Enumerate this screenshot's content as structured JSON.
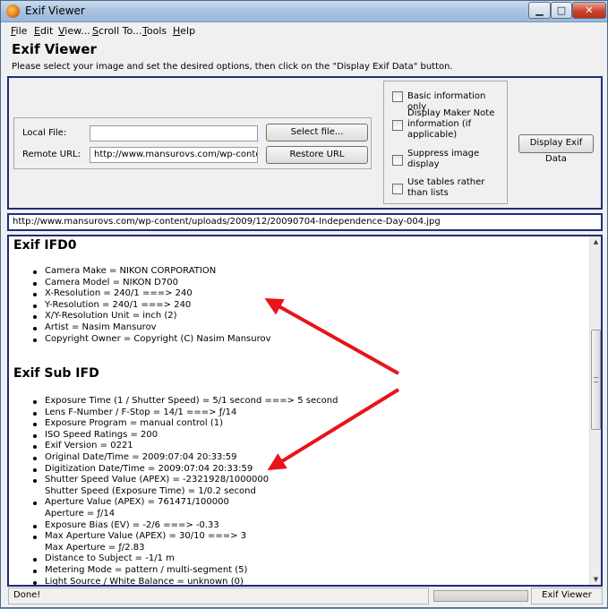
{
  "window": {
    "title": "Exif Viewer",
    "min_glyph": "▁",
    "max_glyph": "□",
    "close_glyph": "✕"
  },
  "menu": {
    "file": {
      "key": "F",
      "rest": "ile"
    },
    "edit": {
      "key": "E",
      "rest": "dit"
    },
    "view": {
      "key": "V",
      "rest": "iew..."
    },
    "scroll": {
      "key": "S",
      "rest": "croll To..."
    },
    "tools": {
      "key": "T",
      "rest": "ools"
    },
    "help": {
      "key": "H",
      "rest": "elp"
    }
  },
  "header": {
    "title": "Exif Viewer",
    "instructions": "Please select your image and set the desired options, then click on the \"Display Exif Data\" button."
  },
  "source": {
    "local_label": "Local File:",
    "local_value": "",
    "select_button": "Select file...",
    "remote_label": "Remote URL:",
    "remote_value": "http://www.mansurovs.com/wp-content",
    "restore_button": "Restore URL"
  },
  "options": {
    "basic": "Basic information only",
    "maker": "Display Maker Note information (if applicable)",
    "suppress": "Suppress image display",
    "tables": "Use tables rather than lists"
  },
  "display_button": "Display Exif Data",
  "url_bar": "http://www.mansurovs.com/wp-content/uploads/2009/12/20090704-Independence-Day-004.jpg",
  "sections": {
    "ifd0": {
      "title": "Exif IFD0",
      "items": [
        "Camera Make = NIKON CORPORATION",
        "Camera Model = NIKON D700",
        "X-Resolution = 240/1 ===> 240",
        "Y-Resolution = 240/1 ===> 240",
        "X/Y-Resolution Unit = inch (2)",
        "Artist = Nasim Mansurov",
        "Copyright Owner = Copyright (C) Nasim Mansurov"
      ]
    },
    "sub": {
      "title": "Exif Sub IFD",
      "items": [
        "Exposure Time (1 / Shutter Speed) = 5/1 second ===> 5 second",
        "Lens F-Number / F-Stop = 14/1 ===> ƒ/14",
        "Exposure Program = manual control (1)",
        "ISO Speed Ratings = 200",
        "Exif Version = 0221",
        "Original Date/Time = 2009:07:04 20:33:59",
        "Digitization Date/Time = 2009:07:04 20:33:59",
        "Shutter Speed Value (APEX) = -2321928/1000000",
        "Shutter Speed (Exposure Time) = 1/0.2 second",
        "Aperture Value (APEX) = 761471/100000",
        "Aperture = ƒ/14",
        "Exposure Bias (EV) = -2/6 ===> -0.33",
        "Max Aperture Value (APEX) = 30/10 ===> 3",
        "Max Aperture = ƒ/2.83",
        "Distance to Subject = -1/1 m",
        "Metering Mode = pattern / multi-segment (5)",
        "Light Source / White Balance = unknown (0)"
      ]
    }
  },
  "scroll": {
    "up_glyph": "▲",
    "down_glyph": "▼"
  },
  "status": {
    "left": "Done!",
    "right": "Exif Viewer"
  },
  "colors": {
    "panel_border": "#1f2d7a",
    "arrow": "#e8141b"
  }
}
